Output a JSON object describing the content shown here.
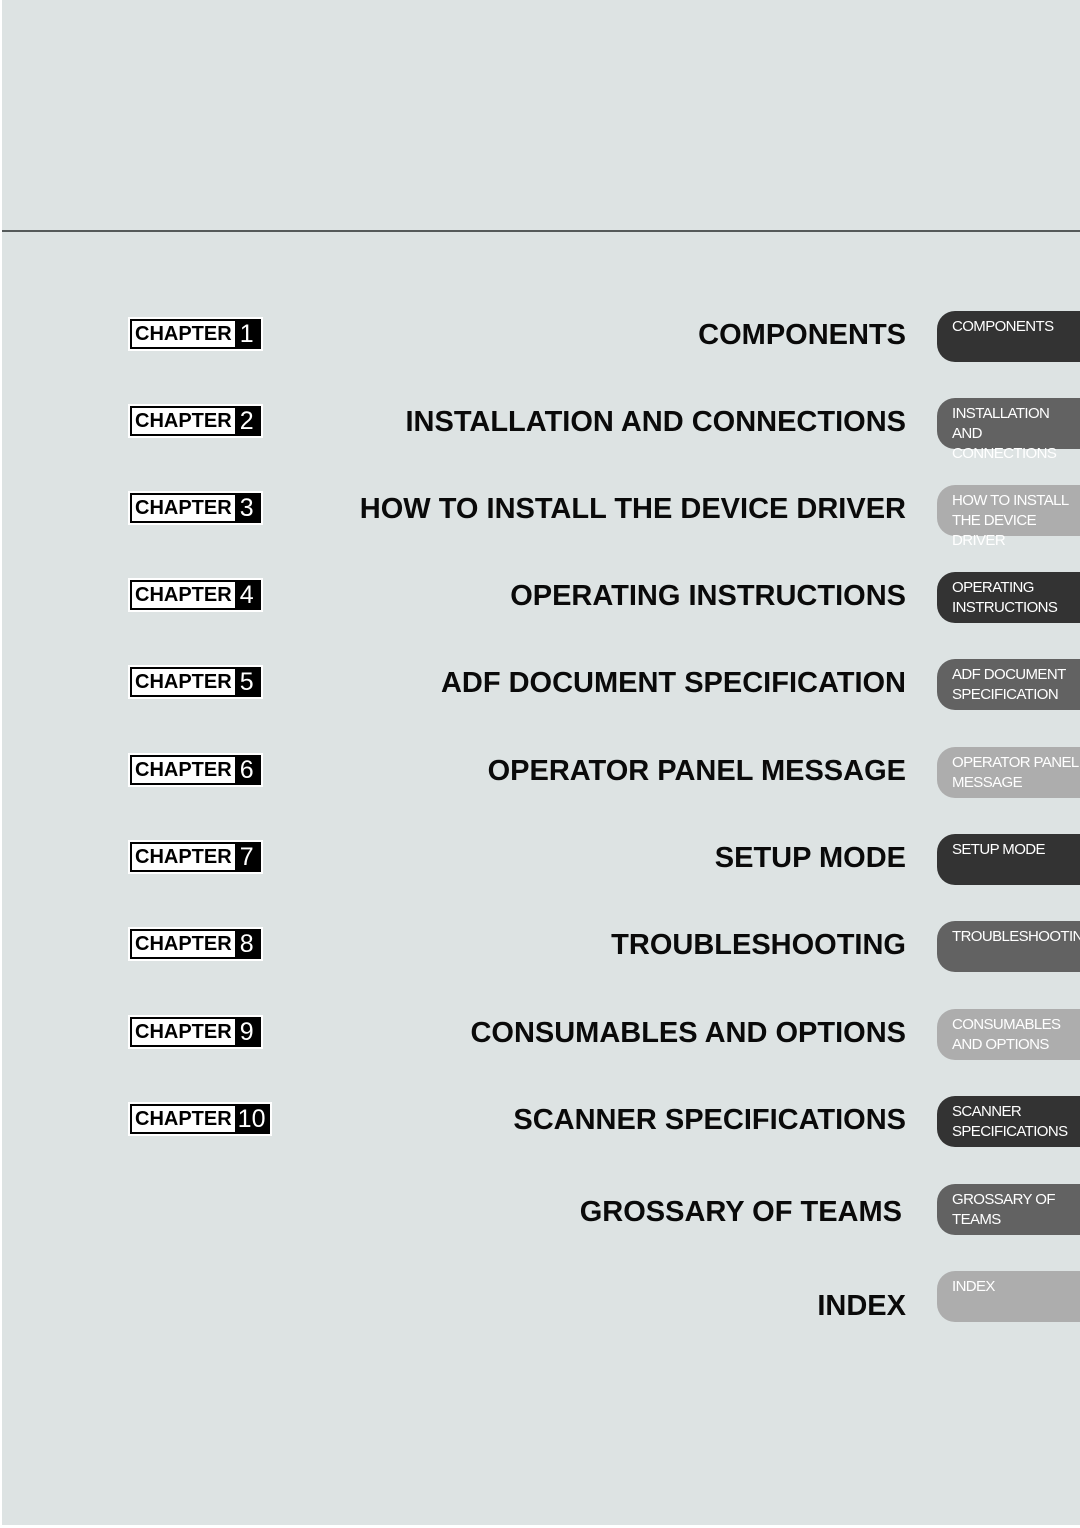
{
  "colors": {
    "background": "#dde3e3",
    "tab_dark": "#333333",
    "tab_mid": "#626262",
    "tab_light": "#adadad",
    "text": "#0a0a0a"
  },
  "chapter_word": "CHAPTER",
  "entries": [
    {
      "chapter": "1",
      "title": "COMPONENTS",
      "tab": "COMPONENTS",
      "tab_shade": "dark"
    },
    {
      "chapter": "2",
      "title": "INSTALLATION AND CONNECTIONS",
      "tab": "INSTALLATION AND\nCONNECTIONS",
      "tab_shade": "mid"
    },
    {
      "chapter": "3",
      "title": "HOW TO INSTALL THE DEVICE DRIVER",
      "tab": "HOW TO INSTALL\nTHE DEVICE DRIVER",
      "tab_shade": "light"
    },
    {
      "chapter": "4",
      "title": "OPERATING INSTRUCTIONS",
      "tab": "OPERATING\nINSTRUCTIONS",
      "tab_shade": "dark"
    },
    {
      "chapter": "5",
      "title": "ADF DOCUMENT SPECIFICATION",
      "tab": "ADF DOCUMENT\nSPECIFICATION",
      "tab_shade": "mid"
    },
    {
      "chapter": "6",
      "title": "OPERATOR PANEL MESSAGE",
      "tab": "OPERATOR PANEL\nMESSAGE",
      "tab_shade": "light"
    },
    {
      "chapter": "7",
      "title": "SETUP MODE",
      "tab": "SETUP MODE",
      "tab_shade": "dark"
    },
    {
      "chapter": "8",
      "title": "TROUBLESHOOTING",
      "tab": "TROUBLESHOOTING",
      "tab_shade": "mid"
    },
    {
      "chapter": "9",
      "title": "CONSUMABLES AND OPTIONS",
      "tab": "CONSUMABLES\nAND OPTIONS",
      "tab_shade": "light"
    },
    {
      "chapter": "10",
      "title": "SCANNER SPECIFICATIONS",
      "tab": "SCANNER\nSPECIFICATIONS",
      "tab_shade": "dark"
    },
    {
      "chapter": null,
      "title": "GROSSARY OF TEAMS",
      "tab": "GROSSARY OF\nTEAMS",
      "tab_shade": "mid"
    },
    {
      "chapter": null,
      "title": "INDEX",
      "tab": "INDEX",
      "tab_shade": "light"
    }
  ]
}
